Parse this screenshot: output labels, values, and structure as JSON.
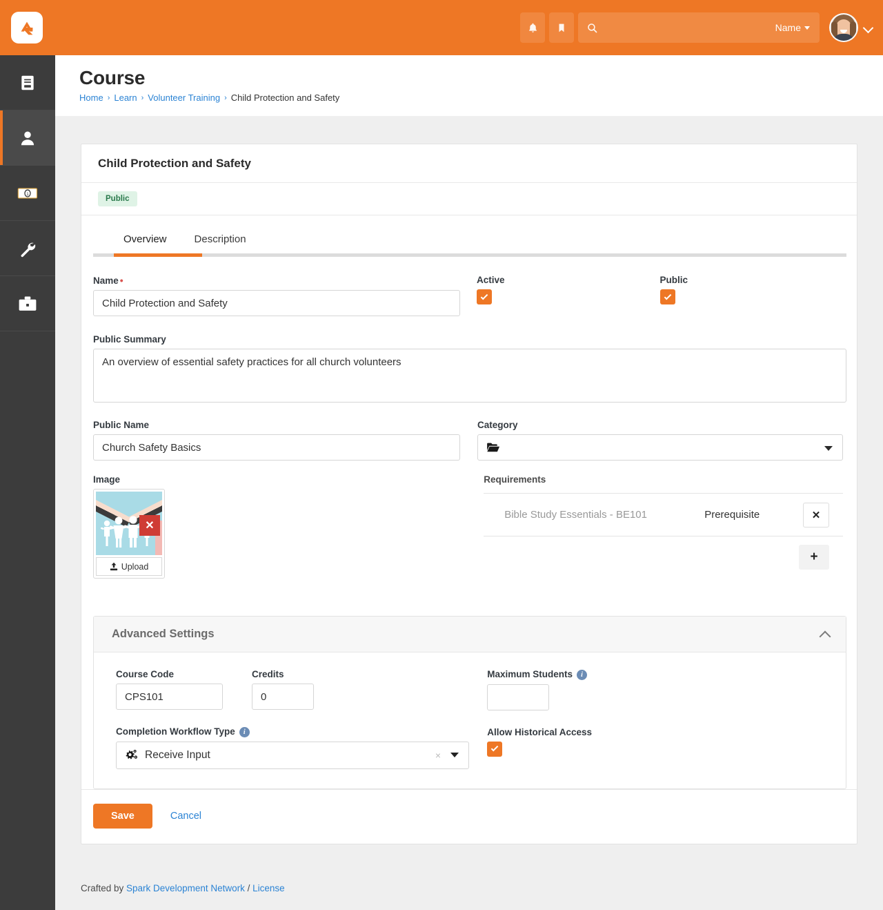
{
  "topbar": {
    "logo_alt": "Rock RMS",
    "notifications_icon": "bell-icon",
    "bookmarks_icon": "bookmark-icon",
    "search_icon": "search-icon",
    "search_value": "",
    "search_placeholder": "",
    "search_scope_label": "Name",
    "avatar_alt": "User avatar",
    "user_menu_icon": "chevron-down-icon",
    "brand_color": "#ee7725"
  },
  "sidebar": {
    "items": [
      {
        "name": "book-icon",
        "label": "Content",
        "active": false
      },
      {
        "name": "person-icon",
        "label": "People",
        "active": true
      },
      {
        "name": "money-icon",
        "label": "Finance",
        "active": false
      },
      {
        "name": "wrench-icon",
        "label": "Tools",
        "active": false
      },
      {
        "name": "briefcase-icon",
        "label": "Admin",
        "active": false
      }
    ]
  },
  "page": {
    "title": "Course",
    "breadcrumb": [
      {
        "label": "Home",
        "link": true
      },
      {
        "label": "Learn",
        "link": true
      },
      {
        "label": "Volunteer Training",
        "link": true
      },
      {
        "label": "Child Protection and Safety",
        "link": false
      }
    ],
    "breadcrumb_separator": "›"
  },
  "card": {
    "title": "Child Protection and Safety",
    "badge": "Public",
    "badge_color": "#2a7a4c",
    "tabs": [
      {
        "label": "Overview",
        "active": true
      },
      {
        "label": "Description",
        "active": false
      }
    ]
  },
  "form": {
    "name_label": "Name",
    "name_required_marker": "•",
    "name_value": "Child Protection and Safety",
    "active_label": "Active",
    "active_checked": true,
    "public_label": "Public",
    "public_checked": true,
    "public_summary_label": "Public Summary",
    "public_summary_value": "An overview of essential safety practices for all church volunteers",
    "public_name_label": "Public Name",
    "public_name_value": "Church Safety Basics",
    "category_label": "Category",
    "category_value": "",
    "category_icon": "folder-open-icon",
    "category_caret": "caret-down-icon",
    "image_label": "Image",
    "image_delete_icon": "delete-x-icon",
    "upload_label": "Upload",
    "upload_icon": "upload-icon"
  },
  "requirements": {
    "title": "Requirements",
    "rows": [
      {
        "name": "Bible Study Essentials - BE101",
        "type": "Prerequisite",
        "remove_icon": "close-x-icon"
      }
    ],
    "add_icon": "plus-icon"
  },
  "advanced": {
    "title": "Advanced Settings",
    "collapse_icon": "chevron-up-icon",
    "course_code_label": "Course Code",
    "course_code_value": "CPS101",
    "credits_label": "Credits",
    "credits_value": "0",
    "maximum_students_label": "Maximum Students",
    "maximum_students_value": "",
    "maximum_students_info_icon": "info-icon",
    "completion_workflow_label": "Completion Workflow Type",
    "completion_workflow_info_icon": "info-icon",
    "completion_workflow_value": "Receive Input",
    "completion_workflow_icon": "gears-icon",
    "completion_workflow_clear": "×",
    "allow_historical_label": "Allow Historical Access",
    "allow_historical_checked": true
  },
  "actions": {
    "save_label": "Save",
    "cancel_label": "Cancel"
  },
  "footer": {
    "prefix": "Crafted by ",
    "spark_label": "Spark Development Network",
    "divider": " / ",
    "license_label": "License"
  }
}
